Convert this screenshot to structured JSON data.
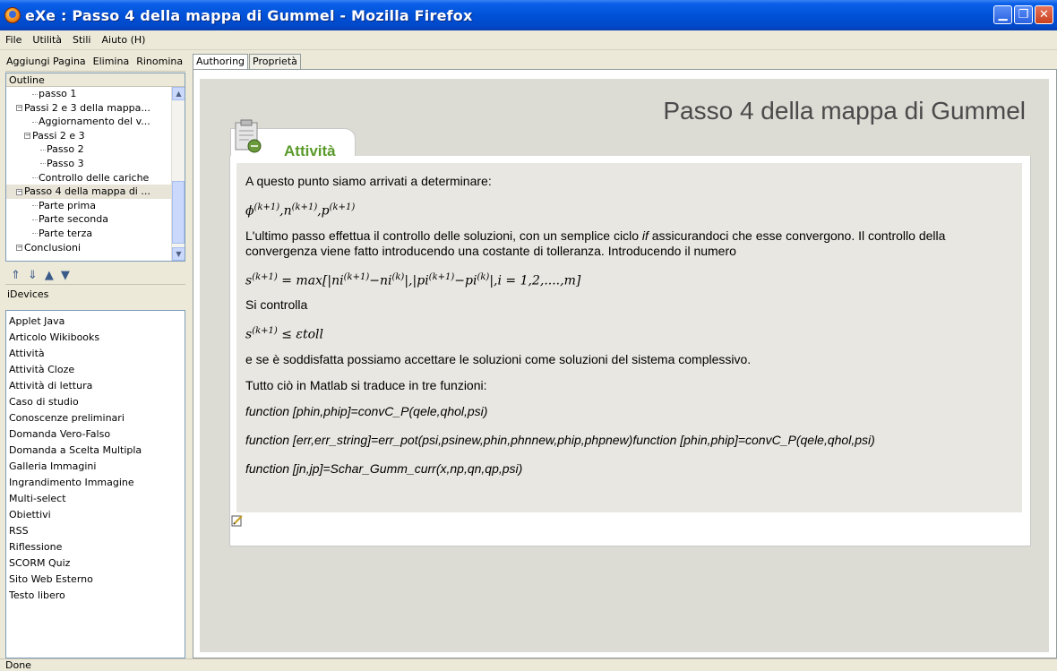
{
  "window": {
    "title": "eXe : Passo 4 della mappa di Gummel - Mozilla Firefox"
  },
  "menu": {
    "items": [
      "File",
      "Utilità",
      "Stili",
      "Aiuto (H)"
    ]
  },
  "left": {
    "toolbar": {
      "add_page": "Aggiungi Pagina",
      "delete": "Elimina",
      "rename": "Rinomina"
    },
    "outline": {
      "header": "Outline",
      "items": [
        {
          "label": "passo 1",
          "indent": 3,
          "type": "leaf"
        },
        {
          "label": "Passi 2 e 3  della mappa...",
          "indent": 1,
          "type": "expanded"
        },
        {
          "label": "Aggiornamento del v...",
          "indent": 3,
          "type": "leaf"
        },
        {
          "label": "Passi 2 e 3",
          "indent": 2,
          "type": "expanded"
        },
        {
          "label": "Passo 2",
          "indent": 4,
          "type": "leaf"
        },
        {
          "label": "Passo 3",
          "indent": 4,
          "type": "leaf"
        },
        {
          "label": "Controllo delle cariche",
          "indent": 3,
          "type": "leaf"
        },
        {
          "label": "Passo 4 della mappa di ...",
          "indent": 1,
          "type": "expanded",
          "selected": true
        },
        {
          "label": "Parte prima",
          "indent": 3,
          "type": "leaf"
        },
        {
          "label": "Parte seconda",
          "indent": 3,
          "type": "leaf"
        },
        {
          "label": "Parte terza",
          "indent": 3,
          "type": "leaf"
        },
        {
          "label": "Conclusioni",
          "indent": 1,
          "type": "expanded"
        }
      ]
    },
    "idevices": {
      "header": "iDevices",
      "items": [
        "Applet Java",
        "Articolo Wikibooks",
        "Attività",
        "Attività Cloze",
        "Attività  di lettura",
        "Caso di studio",
        "Conoscenze preliminari",
        "Domanda Vero-Falso",
        "Domanda a Scelta Multipla",
        "Galleria Immagini",
        "Ingrandimento Immagine",
        "Multi-select",
        "Obiettivi",
        "RSS",
        "Riflessione",
        "SCORM Quiz",
        "Sito Web Esterno",
        "Testo libero"
      ]
    }
  },
  "tabs": [
    "Authoring",
    "Proprietà"
  ],
  "content": {
    "page_title": "Passo 4 della mappa di Gummel",
    "activity_label": "Attività",
    "p1": "A questo punto siamo arrivati a determinare:",
    "math1": "φ(k+1),n(k+1),p(k+1)",
    "p2_a": "L'ultimo passo effettua il controllo delle soluzioni, con un semplice ciclo ",
    "p2_em": "if",
    "p2_b": " assicurandoci che esse convergono. Il controllo della convergenza viene fatto introducendo una costante di tolleranza. Introducendo il numero",
    "math2": "s(k+1) = max[|ni(k+1)−ni(k)|,|pi(k+1)−pi(k)|,i = 1,2,....,m]",
    "p3": "Si controlla",
    "math3": "s(k+1) ≤ εtoll",
    "p4": "e se è soddisfatta possiamo accettare le soluzioni come soluzioni del sistema complessivo.",
    "p5": "Tutto ciò in Matlab si traduce in tre funzioni:",
    "fn1": "function [phin,phip]=convC_P(qele,qhol,psi)",
    "fn2": "function [err,err_string]=err_pot(psi,psinew,phin,phnnew,phip,phpnew)function [phin,phip]=convC_P(qele,qhol,psi)",
    "fn3": "function [jn,jp]=Schar_Gumm_curr(x,np,qn,qp,psi)"
  },
  "status": {
    "text": "Done"
  }
}
